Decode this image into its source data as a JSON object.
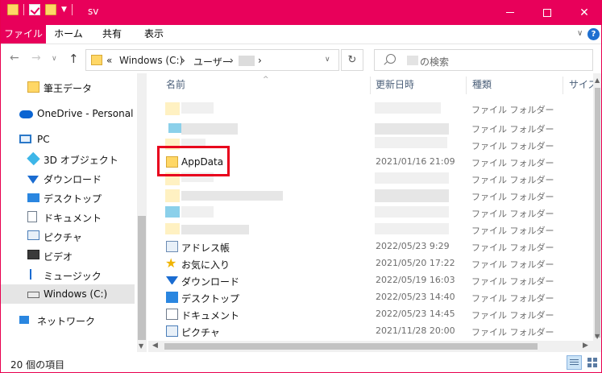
{
  "title_bar": {
    "title": "sv",
    "window_controls": [
      "minimize",
      "maximize",
      "close"
    ]
  },
  "ribbon": {
    "tabs": [
      "ファイル",
      "ホーム",
      "共有",
      "表示"
    ],
    "help_label": "?"
  },
  "address_bar": {
    "overflow": "«",
    "segments": [
      "Windows (C:)",
      "ユーザー"
    ],
    "separator": "›"
  },
  "search": {
    "placeholder": "の検索"
  },
  "sidebar": {
    "items": [
      {
        "label": "筆王データ",
        "icon": "folder-icon"
      },
      {
        "label": "OneDrive - Personal",
        "icon": "cloud-icon"
      },
      {
        "label": "PC",
        "icon": "pc-icon"
      },
      {
        "label": "3D オブジェクト",
        "icon": "3d-objects-icon"
      },
      {
        "label": "ダウンロード",
        "icon": "download-icon"
      },
      {
        "label": "デスクトップ",
        "icon": "desktop-icon"
      },
      {
        "label": "ドキュメント",
        "icon": "document-icon"
      },
      {
        "label": "ピクチャ",
        "icon": "pictures-icon"
      },
      {
        "label": "ビデオ",
        "icon": "video-icon"
      },
      {
        "label": "ミュージック",
        "icon": "music-icon"
      },
      {
        "label": "Windows (C:)",
        "icon": "drive-icon"
      },
      {
        "label": "ネットワーク",
        "icon": "network-icon"
      }
    ]
  },
  "columns": [
    "名前",
    "更新日時",
    "種類",
    "サイズ"
  ],
  "rows": [
    {
      "name": "",
      "date": "",
      "type": "ファイル フォルダー"
    },
    {
      "name": "",
      "date": "",
      "type": "ファイル フォルダー"
    },
    {
      "name": "",
      "date": "",
      "type": "ファイル フォルダー"
    },
    {
      "name": "AppData",
      "date": "2021/01/16 21:09",
      "type": "ファイル フォルダー"
    },
    {
      "name": "",
      "date": "",
      "type": "ファイル フォルダー"
    },
    {
      "name": "",
      "date": "",
      "type": "ファイル フォルダー"
    },
    {
      "name": "",
      "date": "",
      "type": "ファイル フォルダー"
    },
    {
      "name": "",
      "date": "",
      "type": "ファイル フォルダー"
    },
    {
      "name": "アドレス帳",
      "date": "2022/05/23 9:29",
      "type": "ファイル フォルダー"
    },
    {
      "name": "お気に入り",
      "date": "2021/05/20 17:22",
      "type": "ファイル フォルダー"
    },
    {
      "name": "ダウンロード",
      "date": "2022/05/19 16:03",
      "type": "ファイル フォルダー"
    },
    {
      "name": "デスクトップ",
      "date": "2022/05/23 14:40",
      "type": "ファイル フォルダー"
    },
    {
      "name": "ドキュメント",
      "date": "2022/05/23 14:45",
      "type": "ファイル フォルダー"
    },
    {
      "name": "ピクチャ",
      "date": "2021/11/28 20:00",
      "type": "ファイル フォルダー"
    }
  ],
  "status_bar": {
    "item_count": "20 個の項目"
  },
  "colors": {
    "accent": "#e8005a",
    "highlight_box": "#e8001c",
    "folder": "#ffd766"
  }
}
